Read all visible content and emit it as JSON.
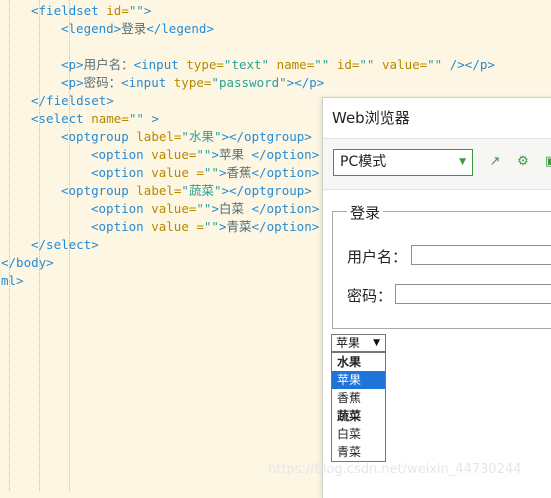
{
  "editor": {
    "lines": [
      {
        "indent": 4,
        "tokens": [
          [
            "tag",
            "<fieldset "
          ],
          [
            "attr",
            "id="
          ],
          [
            "str",
            "\"\""
          ],
          [
            "tag",
            ">"
          ]
        ]
      },
      {
        "indent": 8,
        "tokens": [
          [
            "tag",
            "<legend>"
          ],
          [
            "txt",
            "登录"
          ],
          [
            "tag",
            "</legend>"
          ]
        ]
      },
      {
        "indent": 0,
        "tokens": []
      },
      {
        "indent": 8,
        "tokens": [
          [
            "tag",
            "<p>"
          ],
          [
            "txt",
            "用户名："
          ],
          [
            "tag",
            "<input "
          ],
          [
            "attr",
            "type="
          ],
          [
            "str",
            "\"text\""
          ],
          [
            "attr",
            " name="
          ],
          [
            "str",
            "\"\""
          ],
          [
            "attr",
            " id="
          ],
          [
            "str",
            "\"\""
          ],
          [
            "attr",
            " value="
          ],
          [
            "str",
            "\"\""
          ],
          [
            "tag",
            " /></p>"
          ]
        ]
      },
      {
        "indent": 8,
        "tokens": [
          [
            "tag",
            "<p>"
          ],
          [
            "txt",
            "密码："
          ],
          [
            "tag",
            "<input "
          ],
          [
            "attr",
            "type="
          ],
          [
            "str",
            "\"password\""
          ],
          [
            "tag",
            "></p>"
          ]
        ]
      },
      {
        "indent": 4,
        "tokens": [
          [
            "tag",
            "</fieldset>"
          ]
        ]
      },
      {
        "indent": 4,
        "tokens": [
          [
            "tag",
            "<select "
          ],
          [
            "attr",
            "name="
          ],
          [
            "str",
            "\"\""
          ],
          [
            "tag",
            " >"
          ]
        ]
      },
      {
        "indent": 8,
        "tokens": [
          [
            "tag",
            "<optgroup "
          ],
          [
            "attr",
            "label="
          ],
          [
            "str",
            "\"水果\""
          ],
          [
            "tag",
            "></optgroup>"
          ]
        ]
      },
      {
        "indent": 12,
        "tokens": [
          [
            "tag",
            "<option "
          ],
          [
            "attr",
            "value="
          ],
          [
            "str",
            "\"\""
          ],
          [
            "tag",
            ">"
          ],
          [
            "txt",
            "苹果 "
          ],
          [
            "tag",
            "</option>"
          ]
        ]
      },
      {
        "indent": 12,
        "tokens": [
          [
            "tag",
            "<option "
          ],
          [
            "attr",
            "value ="
          ],
          [
            "str",
            "\"\""
          ],
          [
            "tag",
            ">"
          ],
          [
            "txt",
            "香蕉"
          ],
          [
            "tag",
            "</option>"
          ]
        ]
      },
      {
        "indent": 8,
        "tokens": [
          [
            "tag",
            "<optgroup "
          ],
          [
            "attr",
            "label="
          ],
          [
            "str",
            "\"蔬菜\""
          ],
          [
            "tag",
            "></optgroup>"
          ]
        ]
      },
      {
        "indent": 12,
        "tokens": [
          [
            "tag",
            "<option "
          ],
          [
            "attr",
            "value="
          ],
          [
            "str",
            "\"\""
          ],
          [
            "tag",
            ">"
          ],
          [
            "txt",
            "白菜 "
          ],
          [
            "tag",
            "</option>"
          ]
        ]
      },
      {
        "indent": 12,
        "tokens": [
          [
            "tag",
            "<option "
          ],
          [
            "attr",
            "value ="
          ],
          [
            "str",
            "\"\""
          ],
          [
            "tag",
            ">"
          ],
          [
            "txt",
            "青菜"
          ],
          [
            "tag",
            "</option>"
          ]
        ]
      },
      {
        "indent": 4,
        "tokens": [
          [
            "tag",
            "</select>"
          ]
        ]
      },
      {
        "indent": 0,
        "tokens": [
          [
            "tag",
            "</body>"
          ]
        ]
      },
      {
        "indent": 0,
        "tokens": [
          [
            "tag",
            "ml>"
          ]
        ]
      }
    ]
  },
  "browser": {
    "title": "Web浏览器",
    "mode": "PC模式",
    "icons": [
      "open-external-icon",
      "settings-icon",
      "panel-icon"
    ],
    "form": {
      "legend": "登录",
      "username_label": "用户名：",
      "password_label": "密码："
    },
    "select": {
      "current": "苹果",
      "options": [
        {
          "label": "水果",
          "group": true
        },
        {
          "label": "苹果",
          "selected": true
        },
        {
          "label": "香蕉"
        },
        {
          "label": "蔬菜",
          "group": true
        },
        {
          "label": "白菜"
        },
        {
          "label": "青菜"
        }
      ]
    }
  },
  "watermark": "https://blog.csdn.net/weixin_44730244",
  "colors": {
    "editor_bg": "#fdf6e3",
    "tag": "#268bd2",
    "attr": "#b58900",
    "string": "#2aa198",
    "accent_green": "#3c9a3c",
    "option_selected": "#1e74d9"
  }
}
